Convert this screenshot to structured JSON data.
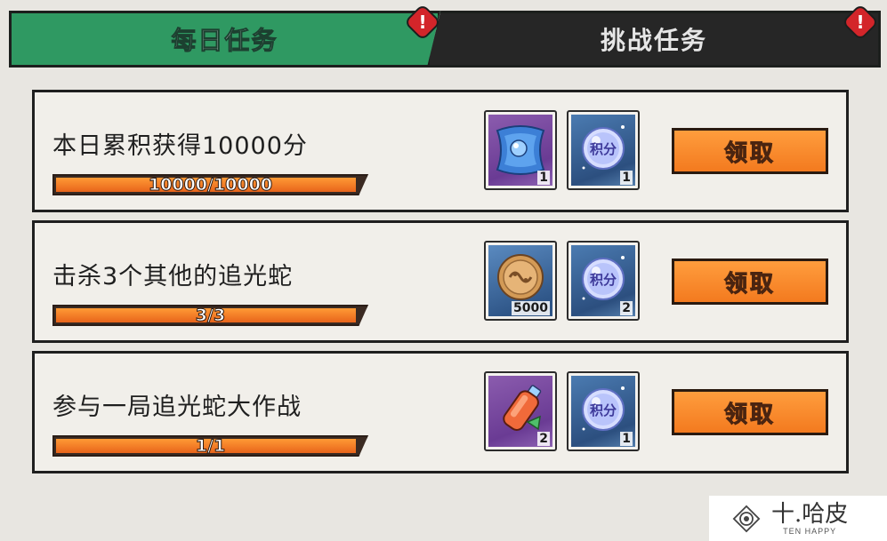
{
  "tabs": [
    {
      "label": "每日任务",
      "active": true,
      "has_alert": true
    },
    {
      "label": "挑战任务",
      "active": false,
      "has_alert": true
    }
  ],
  "alert_symbol": "!",
  "colors": {
    "active_tab": "#2f9962",
    "inactive_tab": "#262626",
    "claim_button": "#f37a1f",
    "progress_fill": "#e8641b",
    "alert": "#d3252a"
  },
  "tasks": [
    {
      "title": "本日累积获得10000分",
      "progress_text": "10000/10000",
      "progress_fraction": 1.0,
      "claim_label": "领取",
      "rewards": [
        {
          "icon": "blue-pillow-icon",
          "count": "1"
        },
        {
          "icon": "points-orb-icon",
          "label": "积分",
          "count": "1"
        }
      ]
    },
    {
      "title": "击杀3个其他的追光蛇",
      "progress_text": "3/3",
      "progress_fraction": 1.0,
      "claim_label": "领取",
      "rewards": [
        {
          "icon": "gold-coin-icon",
          "count": "5000"
        },
        {
          "icon": "points-orb-icon",
          "label": "积分",
          "count": "2"
        }
      ]
    },
    {
      "title": "参与一局追光蛇大作战",
      "progress_text": "1/1",
      "progress_fraction": 1.0,
      "claim_label": "领取",
      "rewards": [
        {
          "icon": "potion-bottle-icon",
          "count": "2"
        },
        {
          "icon": "points-orb-icon",
          "label": "积分",
          "count": "1"
        }
      ]
    }
  ],
  "watermark": {
    "title": "十.哈皮",
    "subtitle": "TEN HAPPY"
  }
}
